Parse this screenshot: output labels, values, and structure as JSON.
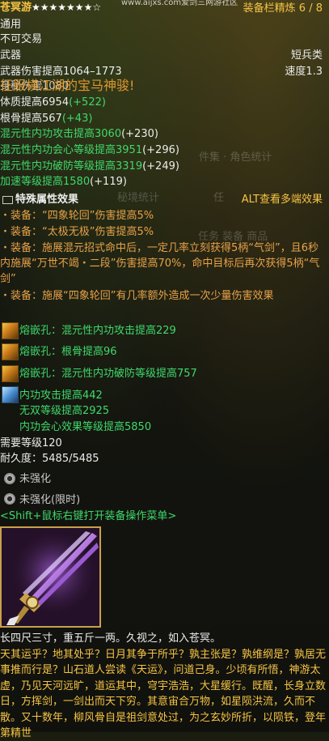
{
  "header": {
    "item_name": "苍冥游",
    "stars_filled": 7,
    "stars_total": 8,
    "star_glyphs": "★★★★★★★☆",
    "watermark": "www.aijxs.com爱剑三网游社区",
    "equip_slot_label": "装备栏精炼 6 / 8"
  },
  "item": {
    "category": "通用",
    "bind": "不可交易",
    "type_label": "武器",
    "type_right": "短兵类",
    "damage_line": "武器伤害提高1064–1773",
    "speed_line": "速度1.3",
    "overlay_banner": "征服横江湖的宝马神骏!",
    "hidden_line": "身秘伤害1080",
    "stats": [
      {
        "text": "体质提高6954",
        "bonus": "(+522)",
        "color": "white"
      },
      {
        "text": "根骨提高567",
        "bonus": "(+43)",
        "color": "white"
      },
      {
        "text": "混元性内功攻击提高3060",
        "bonus": "(+230)",
        "color": "green"
      },
      {
        "text": "混元性内功会心等级提高3951",
        "bonus": "(+296)",
        "color": "green"
      },
      {
        "text": "混元性内功破防等级提高3319",
        "bonus": "(+249)",
        "color": "green"
      },
      {
        "text": "加速等级提高1580",
        "bonus": "(+119)",
        "color": "green"
      }
    ],
    "ghost_labels": {
      "set_stats": "件集 · 角色统计",
      "secret_stats": "秘境统计",
      "ren": "任",
      "tabs": "任务   装备   商品"
    },
    "special_header": "特殊属性效果",
    "alt_hint": "ALT查看多端效果",
    "special_effects": [
      "・装备：“四象轮回”伤害提高5%",
      "・装备：“太极无极”伤害提高5%",
      "・装备：施展混元招式命中后，一定几率立刻获得5柄“气剑”，且6秒内施展“万世不竭・二段”伤害提高70%，命中目标后再次获得5柄“气剑”",
      "・装备：施展“四象轮回”有几率额外造成一次少量伤害效果"
    ],
    "sockets": [
      "熔嵌孔：混元性内功攻击提高229",
      "熔嵌孔：根骨提高96",
      "熔嵌孔：混元性内功破防等级提高757"
    ],
    "enchant": [
      "内功攻击提高442",
      "无双等级提高2925",
      "内功会心效果等级提高5850"
    ],
    "req_level": "需要等级120",
    "durability": "耐久度：5485/5485",
    "strengthen": "未强化",
    "strengthen_timed": "未强化(限时)",
    "shift_hint": "<Shift+鼠标右键打开装备操作菜单>",
    "flavor_short": "长四尺三寸，重五斤一两。久视之，如入苍冥。",
    "flavor_long": "天其运乎？地其处乎？日月其争于所乎？孰主张是？孰维纲是？孰居无事推而行是？山石道人尝读《天运》，问道己身。少顷有所悟，神游太虚，乃见天河远旷，道运其中，穹宇浩浩，大星缓行。既醒，长身立数日，方挥剑，一剑出而天下穷。其意宙合万物，如星陨洪流，久而不散。又十数年，柳风骨自是祖剑意处过，为之玄妙所折，以陨铁，登年第精世"
  },
  "colors": {
    "gold": "#f6c445",
    "green": "#3fd86b",
    "orange": "#e8a24a",
    "pink": "#e39cf0",
    "frame": "#c9a14a"
  }
}
